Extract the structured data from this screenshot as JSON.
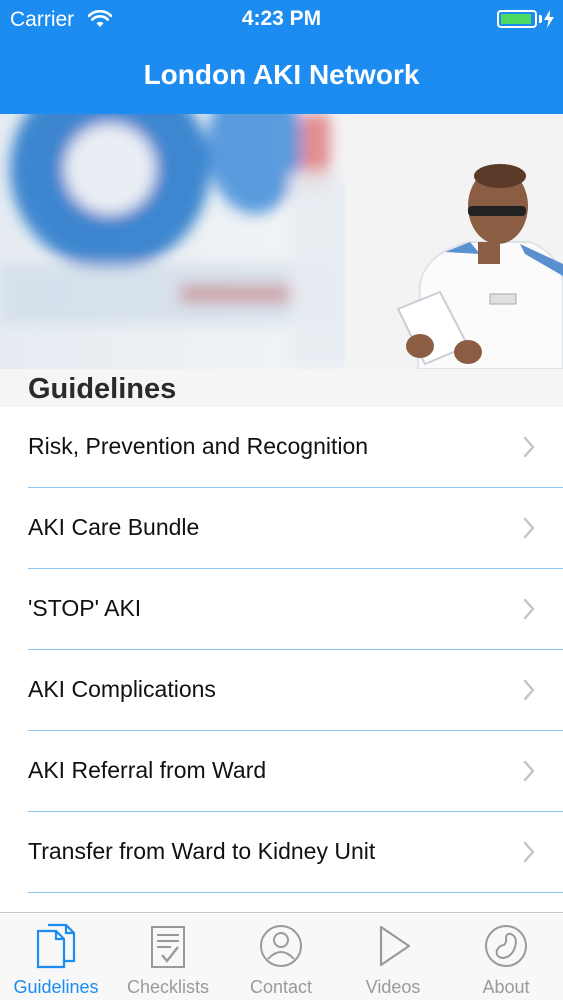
{
  "status_bar": {
    "carrier": "Carrier",
    "time": "4:23 PM",
    "battery_level": 0.95
  },
  "nav": {
    "title": "London AKI Network"
  },
  "hero": {
    "image": "clinician-reading-document-photo"
  },
  "section": {
    "title": "Guidelines"
  },
  "rows": [
    {
      "label": "Risk, Prevention and Recognition"
    },
    {
      "label": "AKI Care Bundle"
    },
    {
      "label": "'STOP' AKI"
    },
    {
      "label": "AKI Complications"
    },
    {
      "label": "AKI Referral from Ward"
    },
    {
      "label": "Transfer from Ward to Kidney Unit"
    }
  ],
  "tabs": [
    {
      "label": "Guidelines",
      "icon": "document-icon",
      "active": true
    },
    {
      "label": "Checklists",
      "icon": "checklist-icon",
      "active": false
    },
    {
      "label": "Contact",
      "icon": "contact-person-icon",
      "active": false
    },
    {
      "label": "Videos",
      "icon": "play-icon",
      "active": false
    },
    {
      "label": "About",
      "icon": "kidney-icon",
      "active": false
    }
  ],
  "colors": {
    "accent": "#1d8cf0",
    "separator": "#8ec7f2",
    "inactive_tab": "#9a9a9a"
  }
}
